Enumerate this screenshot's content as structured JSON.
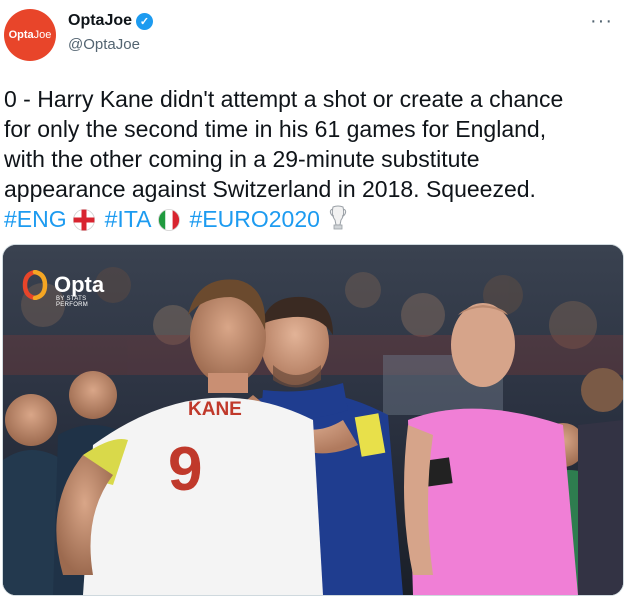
{
  "author": {
    "display_name": "OptaJoe",
    "handle": "@OptaJoe",
    "avatar_text_a": "Opta",
    "avatar_text_b": "Joe",
    "verified": true
  },
  "tweet": {
    "lines": [
      "0 - Harry Kane didn't attempt a shot or create a chance",
      "for only the second time in his 61 games for England,",
      "with the other coming in a 29-minute substitute",
      "appearance against Switzerland in 2018. Squeezed."
    ],
    "hashtags": [
      "#ENG",
      "#ITA",
      "#EURO2020"
    ]
  },
  "media": {
    "watermark": "Opta",
    "watermark_sub": "BY STATS PERFORM",
    "player_name": "KANE",
    "player_number": "9"
  },
  "colors": {
    "accent": "#1d9bf0",
    "brand": "#e8452a",
    "england_shirt": "#f4f4f4",
    "italy_shirt": "#1f3d8f",
    "referee_shirt": "#f07fd6"
  }
}
